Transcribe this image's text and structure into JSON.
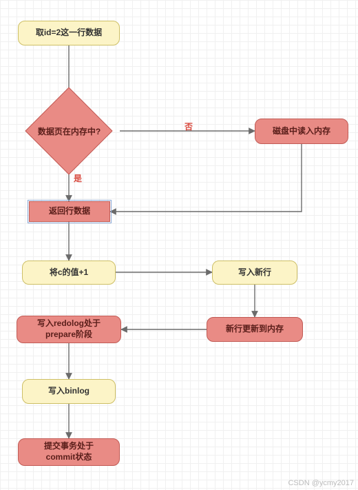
{
  "nodes": {
    "start": "取id=2这一行数据",
    "decision": "数据页在内存中?",
    "disk_read": "磁盘中读入内存",
    "return_row": "返回行数据",
    "inc_c": "将c的值+1",
    "write_new": "写入新行",
    "update_mem": "新行更新到内存",
    "redolog": "写入redolog处于\nprepare阶段",
    "binlog": "写入binlog",
    "commit": "提交事务处于\ncommit状态"
  },
  "edges": {
    "yes": "是",
    "no": "否"
  },
  "watermark": "CSDN @ycmy2017"
}
